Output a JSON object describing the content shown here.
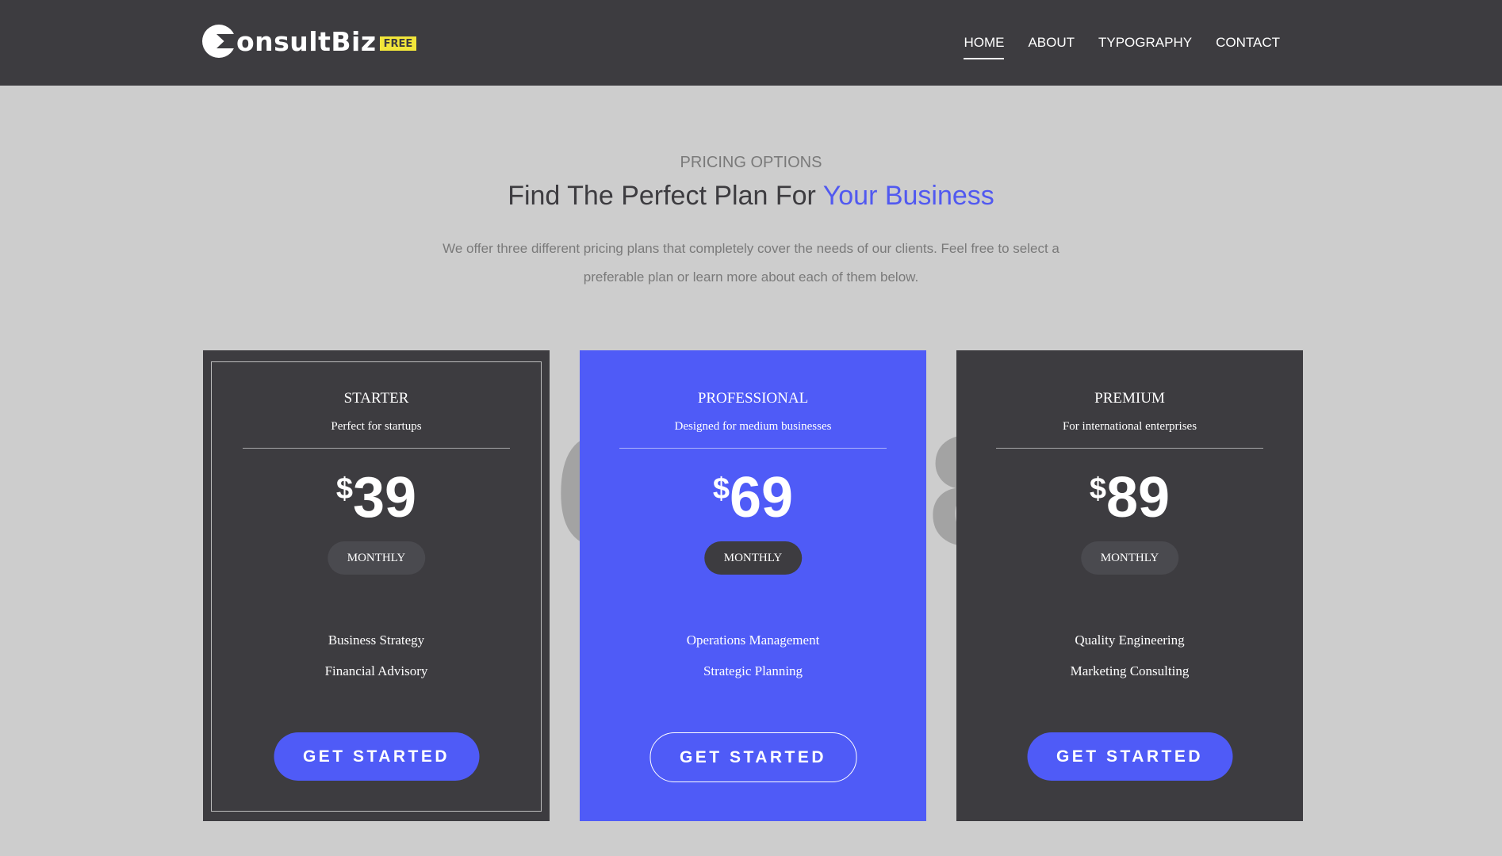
{
  "header": {
    "logo_text": "onsultBiz",
    "logo_badge": "FREE",
    "nav": [
      "HOME",
      "ABOUT",
      "TYPOGRAPHY",
      "CONTACT"
    ],
    "active_nav": "HOME"
  },
  "section": {
    "eyebrow": "PRICING OPTIONS",
    "headline_main": "Find The Perfect Plan For ",
    "headline_accent": "Your Business",
    "intro": "We offer three different pricing plans that completely cover the needs of our clients. Feel free to select a preferable plan or learn more about each of them below."
  },
  "plans": [
    {
      "name": "STARTER",
      "subtitle": "Perfect for startups",
      "currency": "$",
      "price": "39",
      "period": "MONTHLY",
      "features": [
        "Business Strategy",
        "Financial Advisory"
      ],
      "cta": "GET STARTED"
    },
    {
      "name": "PROFESSIONAL",
      "subtitle": "Designed for medium businesses",
      "currency": "$",
      "price": "69",
      "period": "MONTHLY",
      "features": [
        "Operations Management",
        "Strategic Planning"
      ],
      "cta": "GET STARTED"
    },
    {
      "name": "PREMIUM",
      "subtitle": "For international enterprises",
      "currency": "$",
      "price": "89",
      "period": "MONTHLY",
      "features": [
        "Quality Engineering",
        "Marketing Consulting"
      ],
      "cta": "GET STARTED"
    }
  ],
  "colors": {
    "accent": "#4f5bf7",
    "dark": "#3d3c40",
    "page_bg": "#cdcdcd",
    "badge": "#f2e63a"
  }
}
